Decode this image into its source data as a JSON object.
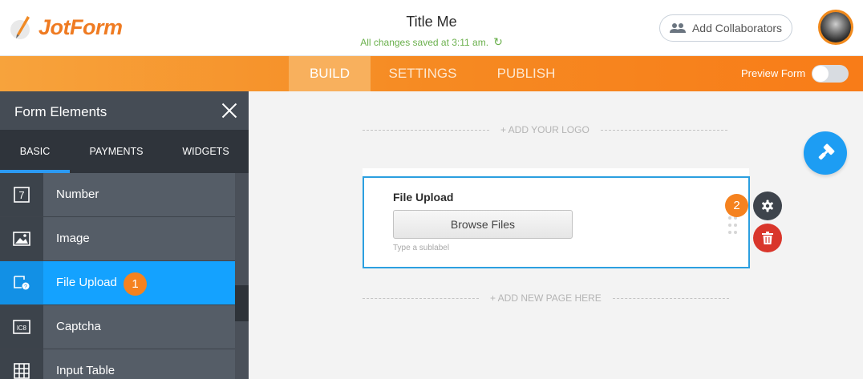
{
  "brand": {
    "logo_text": "JotForm",
    "accent": "#f68a22"
  },
  "header": {
    "form_title": "Title Me",
    "save_status": "All changes saved at 3:11 am.",
    "collab_label": "Add Collaborators"
  },
  "nav": {
    "tabs": [
      {
        "label": "BUILD",
        "active": true
      },
      {
        "label": "SETTINGS",
        "active": false
      },
      {
        "label": "PUBLISH",
        "active": false
      }
    ],
    "preview_label": "Preview Form",
    "preview_enabled": false
  },
  "sidebar": {
    "title": "Form Elements",
    "tabs": [
      {
        "label": "BASIC",
        "active": true
      },
      {
        "label": "PAYMENTS",
        "active": false
      },
      {
        "label": "WIDGETS",
        "active": false
      }
    ],
    "items": [
      {
        "label": "Number",
        "icon": "number-icon",
        "active": false
      },
      {
        "label": "Image",
        "icon": "image-icon",
        "active": false
      },
      {
        "label": "File Upload",
        "icon": "file-upload-icon",
        "active": true,
        "badge": "1"
      },
      {
        "label": "Captcha",
        "icon": "captcha-icon",
        "active": false
      },
      {
        "label": "Input Table",
        "icon": "table-icon",
        "active": false
      }
    ]
  },
  "canvas": {
    "add_logo": "+ ADD YOUR LOGO",
    "add_page": "+ ADD NEW PAGE HERE",
    "field": {
      "label": "File Upload",
      "button_label": "Browse Files",
      "sublabel_placeholder": "Type a sublabel"
    },
    "step_badge": "2"
  }
}
